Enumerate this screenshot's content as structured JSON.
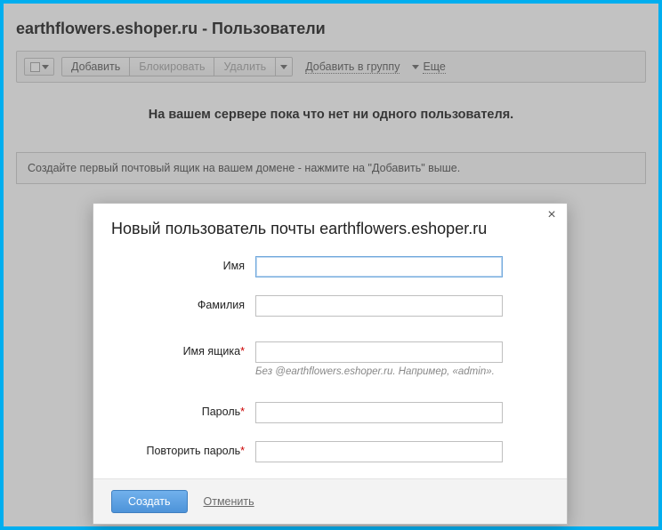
{
  "page": {
    "title": "earthflowers.eshoper.ru - Пользователи",
    "empty_heading": "На вашем сервере пока что нет ни одного пользователя.",
    "hint": "Создайте первый почтовый ящик на вашем домене - нажмите на \"Добавить\" выше."
  },
  "toolbar": {
    "add": "Добавить",
    "block": "Блокировать",
    "delete": "Удалить",
    "add_to_group": "Добавить в группу",
    "more": "Еще"
  },
  "modal": {
    "title": "Новый пользователь почты earthflowers.eshoper.ru",
    "labels": {
      "first_name": "Имя",
      "last_name": "Фамилия",
      "mailbox": "Имя ящика",
      "password": "Пароль",
      "password_repeat": "Повторить пароль"
    },
    "mailbox_hint": "Без @earthflowers.eshoper.ru. Например, «admin».",
    "submit": "Создать",
    "cancel": "Отменить",
    "values": {
      "first_name": "",
      "last_name": "",
      "mailbox": "",
      "password": "",
      "password_repeat": ""
    }
  }
}
